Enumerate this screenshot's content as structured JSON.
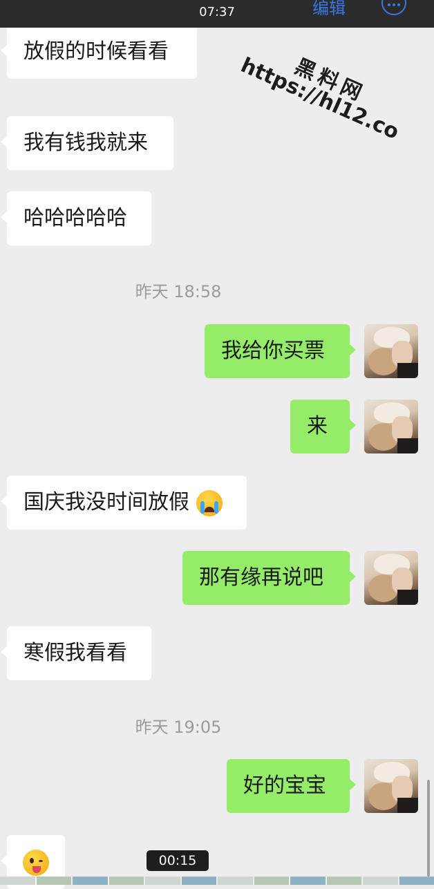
{
  "status_bar": {
    "time": "07:37"
  },
  "header": {
    "edit_label": "编辑",
    "more_icon": "more-circle-icon",
    "accent_color": "#3b78e7"
  },
  "watermark": {
    "line1": "黑料网",
    "line2": "https://hl12.co"
  },
  "messages": [
    {
      "side": "left",
      "text": "放假的时候看看"
    },
    {
      "side": "left",
      "text": "我有钱我就来"
    },
    {
      "side": "left",
      "text": "哈哈哈哈哈"
    },
    {
      "type": "timestamp",
      "text": "昨天 18:58"
    },
    {
      "side": "right",
      "text": "我给你买票"
    },
    {
      "side": "right",
      "text": "来"
    },
    {
      "side": "left",
      "text": "国庆我没时间放假",
      "emoji": "loudly-crying-face"
    },
    {
      "side": "right",
      "text": "那有缘再说吧"
    },
    {
      "side": "left",
      "text": "寒假我看看"
    },
    {
      "type": "timestamp",
      "text": "昨天 19:05"
    },
    {
      "side": "right",
      "text": "好的宝宝"
    },
    {
      "side": "left",
      "emoji": "winking-face-with-tongue"
    }
  ],
  "colors": {
    "sent_bubble": "#95ec69",
    "received_bubble": "#ffffff",
    "background": "#ededed"
  },
  "video_player": {
    "duration": "00:15"
  }
}
